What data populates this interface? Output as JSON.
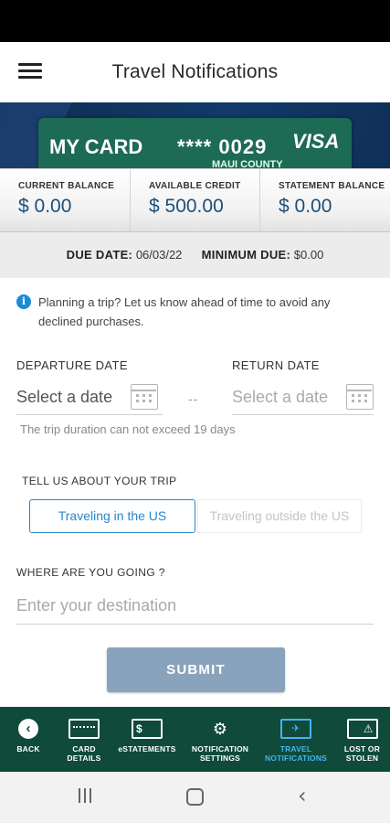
{
  "header": {
    "title": "Travel Notifications"
  },
  "card": {
    "name": "MY CARD",
    "number": "**** 0029",
    "brand": "VISA",
    "issuer": "MAUI COUNTY"
  },
  "balances": [
    {
      "label": "CURRENT BALANCE",
      "value": "$ 0.00"
    },
    {
      "label": "AVAILABLE CREDIT",
      "value": "$ 500.00"
    },
    {
      "label": "STATEMENT BALANCE",
      "value": "$ 0.00"
    }
  ],
  "due": {
    "date_label": "DUE DATE:",
    "date_value": "06/03/22",
    "min_label": "MINIMUM DUE:",
    "min_value": "$0.00"
  },
  "info": {
    "text": "Planning a trip? Let us know ahead of time to avoid any declined purchases."
  },
  "form": {
    "departure_label": "DEPARTURE DATE",
    "departure_placeholder": "Select a date",
    "return_label": "RETURN DATE",
    "return_placeholder": "Select a date",
    "separator": "--",
    "duration_hint": "The trip duration can not exceed 19 days",
    "trip_label": "TELL US ABOUT YOUR TRIP",
    "trip_options": [
      "Traveling in the US",
      "Traveling outside the US"
    ],
    "trip_selected": "Traveling in the US",
    "destination_label": "WHERE ARE YOU GOING ?",
    "destination_placeholder": "Enter your destination",
    "destination_value": "",
    "submit_label": "SUBMIT"
  },
  "bottom_nav": [
    {
      "label": "BACK",
      "icon": "back-icon",
      "active": false
    },
    {
      "label": "CARD DETAILS",
      "icon": "card-details-icon",
      "active": false
    },
    {
      "label": "eSTATEMENTS",
      "icon": "statement-icon",
      "active": false
    },
    {
      "label": "NOTIFICATION SETTINGS",
      "icon": "gear-bell-icon",
      "active": false
    },
    {
      "label": "TRAVEL NOTIFICATIONS",
      "icon": "travel-card-icon",
      "active": true
    },
    {
      "label": "LOST OR STOLEN",
      "icon": "warning-card-icon",
      "active": false
    }
  ],
  "colors": {
    "accent": "#2a86c8",
    "nav_bg": "#0f4a3a",
    "card_bg": "#1d6a55",
    "submit_bg": "#8aa3bc",
    "active_nav": "#46b4f0"
  }
}
